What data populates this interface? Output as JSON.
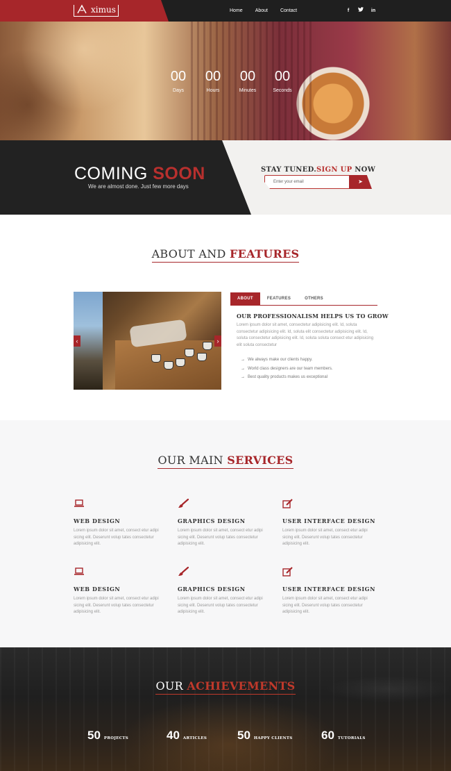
{
  "header": {
    "logo_text": "ximus",
    "nav": [
      "Home",
      "About",
      "Contact"
    ],
    "social": [
      {
        "icon": "facebook-icon",
        "glyph": "f"
      },
      {
        "icon": "twitter-icon",
        "glyph": "t"
      },
      {
        "icon": "linkedin-icon",
        "glyph": "in"
      }
    ]
  },
  "countdown": [
    {
      "value": "00",
      "label": "Days"
    },
    {
      "value": "00",
      "label": "Hours"
    },
    {
      "value": "00",
      "label": "Minutes"
    },
    {
      "value": "00",
      "label": "Seconds"
    }
  ],
  "coming_soon": {
    "title_a": "COMING ",
    "title_b": "SOON",
    "subtitle": "We are almost done. Just few more days"
  },
  "signup": {
    "title_a": "STAY TUNED.",
    "title_b": "SIGN UP",
    "title_c": " NOW",
    "placeholder": "Enter your email",
    "button_glyph": "➤"
  },
  "about": {
    "heading_a": "ABOUT AND ",
    "heading_b": "FEATURES",
    "tabs": [
      "ABOUT",
      "FEATURES",
      "OTHERS"
    ],
    "subheading": "OUR PROFESSIONALISM HELPS US TO GROW",
    "paragraph": "Lorem ipsum dolor sit amet, consectetur adipisicing elit. Id, soluta consectetur adipisicing elit. Id, soluta elit consectetur adipisicing elit. Id, soluta consectetur adipisicing elit. Id, soluta soluta consect etur adipisicing elit soluta consectetur",
    "list": [
      "We always make our clients happy.",
      "World class designers are our team members.",
      "Best quality products makes us exceptional"
    ],
    "prev_glyph": "‹",
    "next_glyph": "›"
  },
  "services": {
    "heading_a": "OUR MAIN ",
    "heading_b": "SERVICES",
    "items": [
      {
        "title": "WEB DESIGN",
        "icon": "laptop-icon",
        "text": "Lorem ipsum dolor sit amet, consect etur adipi sicing elit. Deserunt volup tates consectetur adipisicing elit."
      },
      {
        "title": "GRAPHICS DESIGN",
        "icon": "paintbrush-icon",
        "text": "Lorem ipsum dolor sit amet, consect etur adipi sicing elit. Deserunt volup tates consectetur adipisicing elit."
      },
      {
        "title": "USER INTERFACE DESIGN",
        "icon": "edit-icon",
        "text": "Lorem ipsum dolor sit amet, consect etur adipi sicing elit. Deserunt volup tates consectetur adipisicing elit."
      },
      {
        "title": "WEB DESIGN",
        "icon": "laptop-icon",
        "text": "Lorem ipsum dolor sit amet, consect etur adipi sicing elit. Deserunt volup tates consectetur adipisicing elit."
      },
      {
        "title": "GRAPHICS DESIGN",
        "icon": "paintbrush-icon",
        "text": "Lorem ipsum dolor sit amet, consect etur adipi sicing elit. Deserunt volup tates consectetur adipisicing elit."
      },
      {
        "title": "USER INTERFACE DESIGN",
        "icon": "edit-icon",
        "text": "Lorem ipsum dolor sit amet, consect etur adipi sicing elit. Deserunt volup tates consectetur adipisicing elit."
      }
    ]
  },
  "achievements": {
    "heading_a": "OUR ",
    "heading_b": "ACHIEVEMENTS",
    "stats": [
      {
        "value": "50",
        "label": "PROJECTS"
      },
      {
        "value": "40",
        "label": "ARTICLES"
      },
      {
        "value": "50",
        "label": "HAPPY CLIENTS"
      },
      {
        "value": "60",
        "label": "TUTORIALS"
      }
    ]
  },
  "colors": {
    "accent": "#a7262a",
    "dark": "#1f1f1f"
  }
}
